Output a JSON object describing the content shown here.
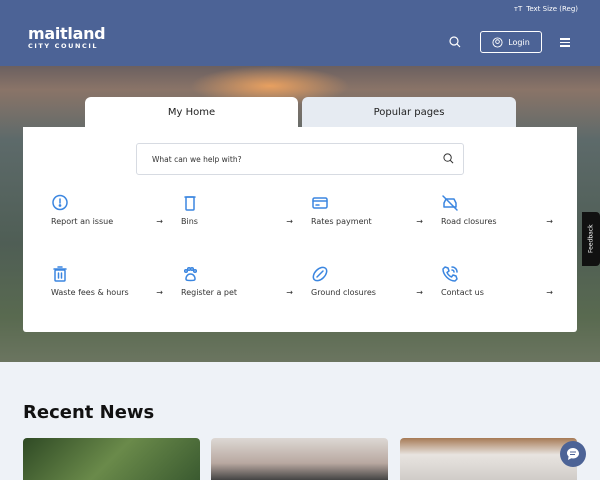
{
  "header": {
    "text_size": "Text Size (Reg)",
    "logo_main": "maitland",
    "logo_sub": "CITY COUNCIL",
    "login": "Login"
  },
  "tabs": [
    {
      "label": "My Home"
    },
    {
      "label": "Popular pages"
    }
  ],
  "search": {
    "placeholder": "What can we help with?"
  },
  "quick_links": [
    {
      "label": "Report an issue",
      "icon": "alert-bubble-icon"
    },
    {
      "label": "Bins",
      "icon": "bin-icon"
    },
    {
      "label": "Rates payment",
      "icon": "card-icon"
    },
    {
      "label": "Road closures",
      "icon": "car-off-icon"
    },
    {
      "label": "Waste fees & hours",
      "icon": "trash-icon"
    },
    {
      "label": "Register a pet",
      "icon": "paw-icon"
    },
    {
      "label": "Ground closures",
      "icon": "football-icon"
    },
    {
      "label": "Contact us",
      "icon": "phone-icon"
    }
  ],
  "arrow": "→",
  "feedback": "Feedback",
  "news": {
    "title": "Recent News"
  },
  "colors": {
    "brand": "#4c6396",
    "accent": "#3b86e0"
  }
}
